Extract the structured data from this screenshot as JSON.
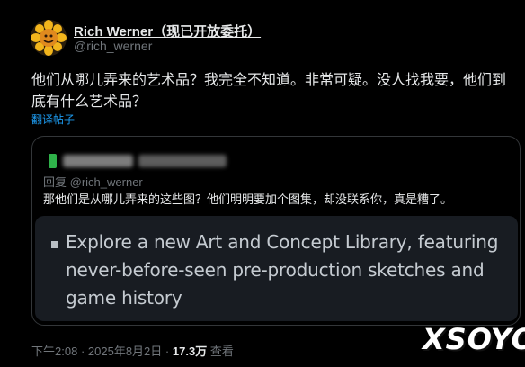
{
  "author": {
    "name": "Rich Werner（现已开放委托）",
    "handle": "@rich_werner",
    "avatar_icon": "sunflower-avatar-icon"
  },
  "tweet": {
    "text": "他们从哪儿弄来的艺术品？我完全不知道。非常可疑。没人找我要，他们到底有什么艺术品？",
    "translate_label": "翻译帖子"
  },
  "quote": {
    "reply_prefix": "回复",
    "reply_handle": "@rich_werner",
    "text": "那他们是从哪儿弄来的这些图？他们明明要加个图集，却没联系你，真是糟了。",
    "embed_text": "Explore a new Art and Concept Library, featuring never-before-seen pre-production sketches and game history"
  },
  "meta": {
    "time": "下午2:08",
    "date": "2025年8月2日",
    "separator": "·",
    "views_count": "17.3万",
    "views_label": "查看"
  },
  "watermark": "XSOYO",
  "colors": {
    "background": "#000000",
    "link": "#1d9bf0",
    "secondary_text": "#71767b",
    "embed_bg": "#181c22"
  }
}
